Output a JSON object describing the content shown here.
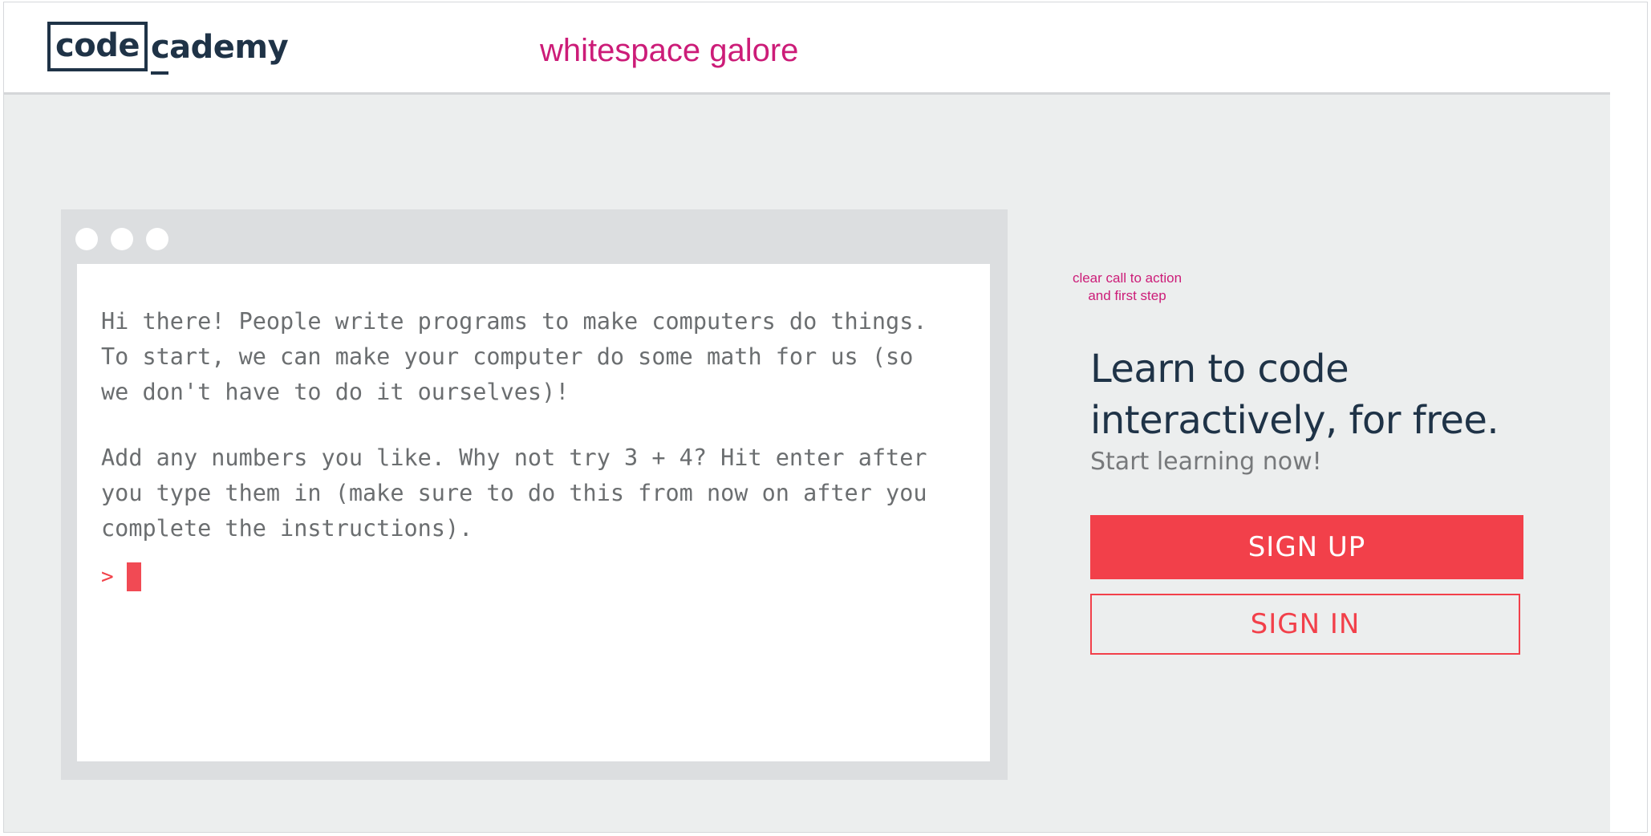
{
  "header": {
    "logo_part1": "code",
    "logo_part2": "cademy",
    "annotation": "whitespace galore"
  },
  "terminal": {
    "window_dots": [
      "dot",
      "dot",
      "dot"
    ],
    "paragraph1": "Hi there! People write programs to make computers do things. To start, we can make your computer do some math for us (so we don't have to do it ourselves)!",
    "paragraph2": "Add any numbers you like. Why not try 3 + 4? Hit enter after you type them in (make sure to do this from now on after you complete the instructions).",
    "prompt_symbol": ">"
  },
  "cta": {
    "annotation_line1": "clear call to action",
    "annotation_line2": "and first step",
    "headline_line1": "Learn to code",
    "headline_line2": "interactively, for free.",
    "subhead": "Start learning now!",
    "signup_label": "SIGN UP",
    "signin_label": "SIGN IN"
  },
  "colors": {
    "brand_navy": "#1f3347",
    "accent_red": "#f2404a",
    "annotation_magenta": "#cc1c78",
    "background_gray": "#eceeee"
  }
}
